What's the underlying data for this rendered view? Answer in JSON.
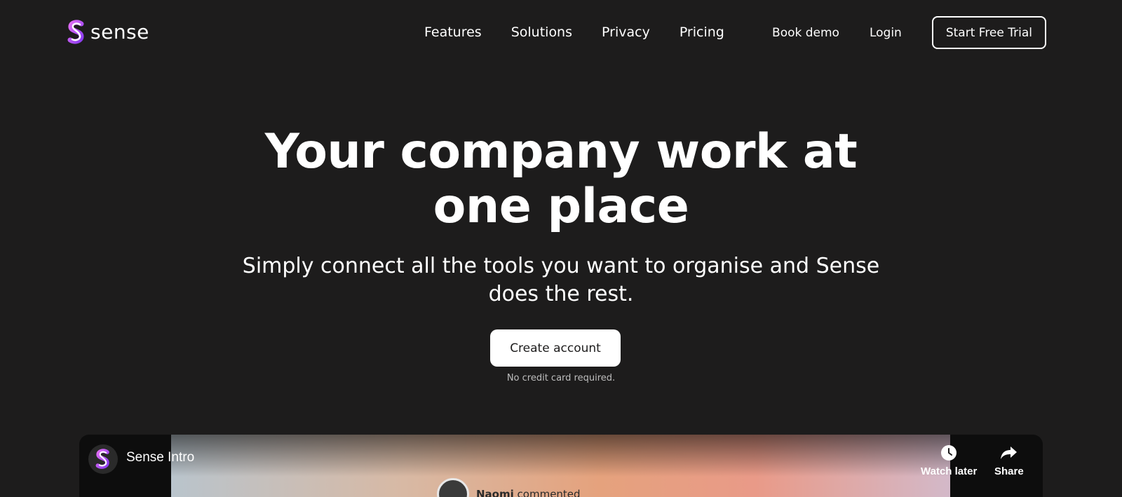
{
  "brand": {
    "name": "sense",
    "gradient_start": "#c44cf0",
    "gradient_end": "#7a3cf5"
  },
  "nav": {
    "items": [
      "Features",
      "Solutions",
      "Privacy",
      "Pricing"
    ],
    "book_demo": "Book demo",
    "login": "Login",
    "start_trial": "Start Free Trial"
  },
  "hero": {
    "title_line1": "Your company work at",
    "title_line2": "one place",
    "subtitle_line1": "Simply connect all the tools you want to organise and Sense",
    "subtitle_line2": "does the rest.",
    "cta": "Create account",
    "note": "No credit card required."
  },
  "video": {
    "title": "Sense Intro",
    "watch_later": "Watch later",
    "share": "Share",
    "commenter_name": "Naomi",
    "commenter_action": "commented",
    "icons": [
      "clock-icon",
      "share-arrow-icon"
    ]
  },
  "colors": {
    "background": "#1d1c1c",
    "text": "#ffffff",
    "cta_bg": "#ffffff"
  }
}
